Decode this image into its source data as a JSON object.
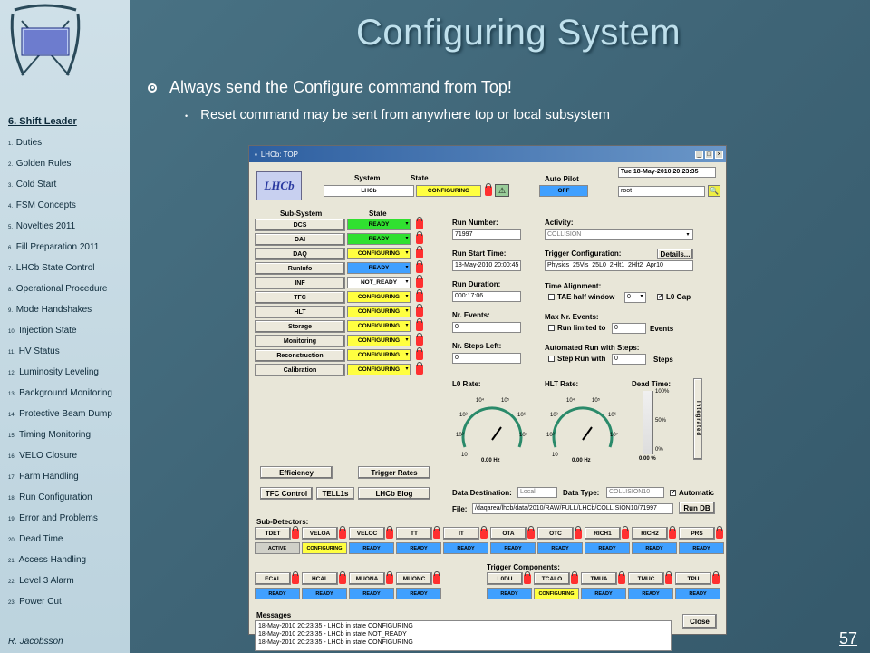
{
  "slide": {
    "title": "Configuring System",
    "bullet_main": "Always send the Configure command from Top!",
    "bullet_sub": "Reset command may be sent from anywhere top or local subsystem",
    "page_number": "57",
    "author": "R. Jacobsson"
  },
  "sidebar": {
    "heading": "6. Shift Leader",
    "items": [
      {
        "n": "1.",
        "label": "Duties"
      },
      {
        "n": "2.",
        "label": "Golden Rules"
      },
      {
        "n": "3.",
        "label": "Cold Start"
      },
      {
        "n": "4.",
        "label": "FSM Concepts"
      },
      {
        "n": "5.",
        "label": "Novelties 2011"
      },
      {
        "n": "6.",
        "label": "Fill Preparation 2011"
      },
      {
        "n": "7.",
        "label": "LHCb State Control"
      },
      {
        "n": "8.",
        "label": "Operational Procedure"
      },
      {
        "n": "9.",
        "label": "Mode Handshakes"
      },
      {
        "n": "10.",
        "label": "Injection State"
      },
      {
        "n": "11.",
        "label": "HV Status"
      },
      {
        "n": "12.",
        "label": "Luminosity Leveling"
      },
      {
        "n": "13.",
        "label": "Background Monitoring"
      },
      {
        "n": "14.",
        "label": "Protective Beam Dump"
      },
      {
        "n": "15.",
        "label": "Timing Monitoring"
      },
      {
        "n": "16.",
        "label": "VELO Closure"
      },
      {
        "n": "17.",
        "label": "Farm Handling"
      },
      {
        "n": "18.",
        "label": "Run Configuration"
      },
      {
        "n": "19.",
        "label": "Error and Problems"
      },
      {
        "n": "20.",
        "label": "Dead Time"
      },
      {
        "n": "21.",
        "label": "Access Handling"
      },
      {
        "n": "22.",
        "label": "Level 3 Alarm"
      },
      {
        "n": "23.",
        "label": "Power Cut"
      }
    ]
  },
  "window": {
    "title": "LHCb: TOP",
    "system_label": "System",
    "state_label": "State",
    "system_name": "LHCb",
    "system_state": "CONFIGURING",
    "autopilot_label": "Auto Pilot",
    "autopilot_state": "OFF",
    "datetime": "Tue 18-May-2010     20:23:35",
    "user": "root",
    "subsystem_label": "Sub-System",
    "subsystem_state_label": "State",
    "subsystems": [
      {
        "name": "DCS",
        "state": "READY",
        "color": "green"
      },
      {
        "name": "DAI",
        "state": "READY",
        "color": "green"
      },
      {
        "name": "DAQ",
        "state": "CONFIGURING",
        "color": "yellow"
      },
      {
        "name": "RunInfo",
        "state": "READY",
        "color": "blue"
      },
      {
        "name": "INF",
        "state": "NOT_READY",
        "color": "white"
      },
      {
        "name": "TFC",
        "state": "CONFIGURING",
        "color": "yellow"
      },
      {
        "name": "HLT",
        "state": "CONFIGURING",
        "color": "yellow"
      },
      {
        "name": "Storage",
        "state": "CONFIGURING",
        "color": "yellow"
      },
      {
        "name": "Monitoring",
        "state": "CONFIGURING",
        "color": "yellow"
      },
      {
        "name": "Reconstruction",
        "state": "CONFIGURING",
        "color": "yellow"
      },
      {
        "name": "Calibration",
        "state": "CONFIGURING",
        "color": "yellow"
      }
    ],
    "run_number_label": "Run Number:",
    "run_number": "71997",
    "run_start_label": "Run Start Time:",
    "run_start": "18-May-2010 20:00:45",
    "run_duration_label": "Run Duration:",
    "run_duration": "000:17:06",
    "nr_events_label": "Nr. Events:",
    "nr_events": "0",
    "nr_steps_label": "Nr. Steps Left:",
    "nr_steps": "0",
    "activity_label": "Activity:",
    "activity": "COLLISION",
    "trigger_conf_label": "Trigger Configuration:",
    "trigger_conf": "Physics_25Vis_25L0_2Hlt1_2Hlt2_Apr10",
    "details_label": "Details...",
    "time_align_label": "Time Alignment:",
    "tae_label": "TAE half window",
    "tae_value": "0",
    "l0gap_label": "L0 Gap",
    "max_events_label": "Max Nr. Events:",
    "run_limited_label": "Run limited to",
    "run_limited_value": "0",
    "events_label": "Events",
    "auto_steps_label": "Automated Run with Steps:",
    "step_run_label": "Step Run with",
    "step_run_value": "0",
    "steps_label": "Steps",
    "l0rate_label": "L0 Rate:",
    "l0rate_value": "0.00 Hz",
    "hltrate_label": "HLT Rate:",
    "hltrate_value": "0.00 Hz",
    "deadtime_label": "Dead Time:",
    "deadtime_value": "0.00 %",
    "dt_ticks": [
      "100%",
      "50%",
      "0%"
    ],
    "integrated_label": "Integrated",
    "gauge_ticks": [
      "10",
      "10²",
      "10³",
      "10⁴",
      "10⁵",
      "10⁶",
      "10⁷"
    ],
    "efficiency_btn": "Efficiency",
    "trigger_rates_btn": "Trigger Rates",
    "tfc_control_btn": "TFC Control",
    "tell1s_btn": "TELL1s",
    "lhcb_elog_btn": "LHCb Elog",
    "data_dest_label": "Data Destination:",
    "data_dest": "Local",
    "data_type_label": "Data Type:",
    "data_type": "COLLISION10",
    "automatic_label": "Automatic",
    "file_label": "File:",
    "file_value": "/daqarea/lhcb/data/2010/RAW/FULL/LHCb/COLLISION10/71997",
    "run_db_btn": "Run DB",
    "subdetectors_label": "Sub-Detectors:",
    "subdetectors_row1": [
      {
        "name": "TDET",
        "state": "ACTIVE",
        "color": "grey"
      },
      {
        "name": "VELOA",
        "state": "CONFIGURING",
        "color": "yellow"
      },
      {
        "name": "VELOC",
        "state": "READY",
        "color": "blue"
      },
      {
        "name": "TT",
        "state": "READY",
        "color": "blue"
      },
      {
        "name": "IT",
        "state": "READY",
        "color": "blue"
      },
      {
        "name": "OTA",
        "state": "READY",
        "color": "blue"
      },
      {
        "name": "OTC",
        "state": "READY",
        "color": "blue"
      },
      {
        "name": "RICH1",
        "state": "READY",
        "color": "blue"
      },
      {
        "name": "RICH2",
        "state": "READY",
        "color": "blue"
      },
      {
        "name": "PRS",
        "state": "READY",
        "color": "blue"
      }
    ],
    "subdetectors_row2": [
      {
        "name": "ECAL",
        "state": "READY",
        "color": "blue"
      },
      {
        "name": "HCAL",
        "state": "READY",
        "color": "blue"
      },
      {
        "name": "MUONA",
        "state": "READY",
        "color": "blue"
      },
      {
        "name": "MUONC",
        "state": "READY",
        "color": "blue"
      }
    ],
    "trigger_components_label": "Trigger Components:",
    "trigger_components": [
      {
        "name": "L0DU",
        "state": "READY",
        "color": "blue"
      },
      {
        "name": "TCALO",
        "state": "CONFIGURING",
        "color": "yellow"
      },
      {
        "name": "TMUA",
        "state": "READY",
        "color": "blue"
      },
      {
        "name": "TMUC",
        "state": "READY",
        "color": "blue"
      },
      {
        "name": "TPU",
        "state": "READY",
        "color": "blue"
      }
    ],
    "messages_label": "Messages",
    "messages": [
      "18-May-2010 20:23:35 - LHCb in state CONFIGURING",
      "18-May-2010 20:23:35 - LHCb in state NOT_READY",
      "18-May-2010 20:23:35 - LHCb in state CONFIGURING"
    ],
    "close_btn": "Close"
  },
  "colors": {
    "ready_green": "#30e030",
    "configuring_yellow": "#ffff40",
    "ready_blue": "#40a0ff",
    "slide_bg": "#3f6577",
    "sidebar_bg": "#c4d8e2"
  }
}
